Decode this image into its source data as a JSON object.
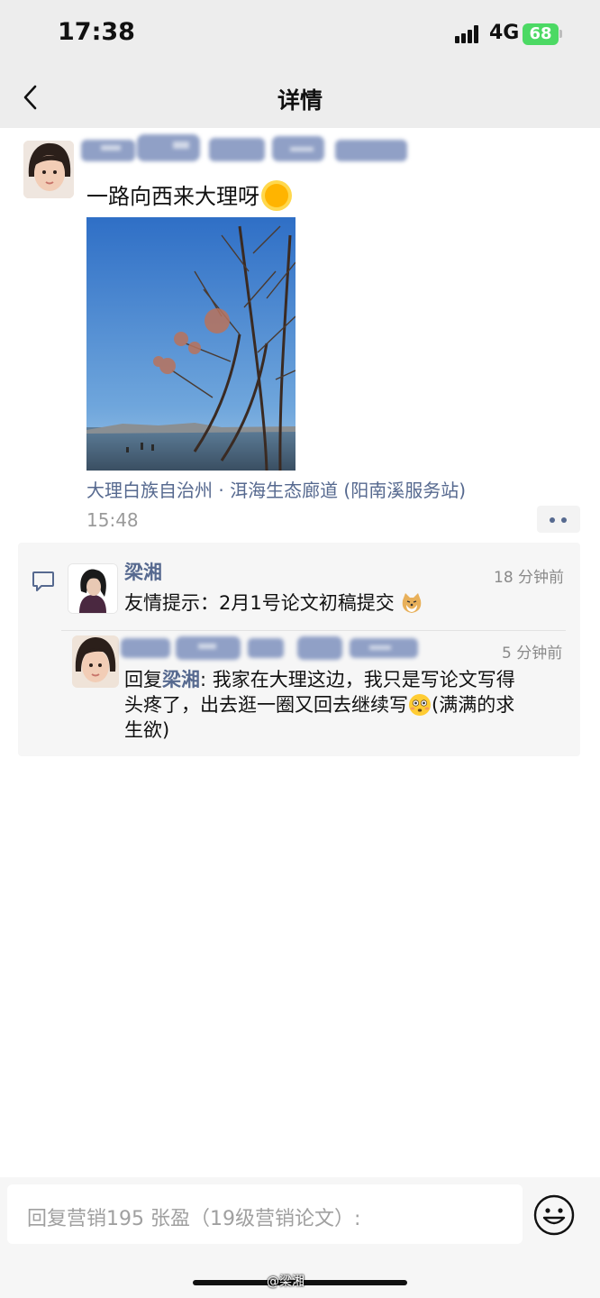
{
  "status_bar": {
    "time": "17:38",
    "network": "4G",
    "battery": "68"
  },
  "nav": {
    "title": "详情"
  },
  "post": {
    "text": "一路向西来大理呀",
    "location": "大理白族自治州 · 洱海生态廊道 (阳南溪服务站)",
    "time": "15:48"
  },
  "comments": [
    {
      "author": "梁湘",
      "time": "18 分钟前",
      "text": "友情提示：2月1号论文初稿提交"
    },
    {
      "time": "5 分钟前",
      "reply_prefix": "回复",
      "reply_to": "梁湘",
      "text_line1": ": 我家在大理这边，我只是写论文写得",
      "text_line2": "头疼了，出去逛一圈又回去继续写",
      "text_line2_tail": "(满满的求",
      "text_line3": "生欲)"
    }
  ],
  "input": {
    "placeholder": "回复营销195 张盈（19级营销论文）:"
  },
  "watermark": "@梁湘",
  "icons": [
    "back-arrow-icon",
    "comment-icon",
    "emoji-icon",
    "sun-emoji-icon",
    "dog-emoji-icon",
    "flushed-emoji-icon",
    "signal-icon",
    "battery-icon",
    "more-dots-icon"
  ]
}
